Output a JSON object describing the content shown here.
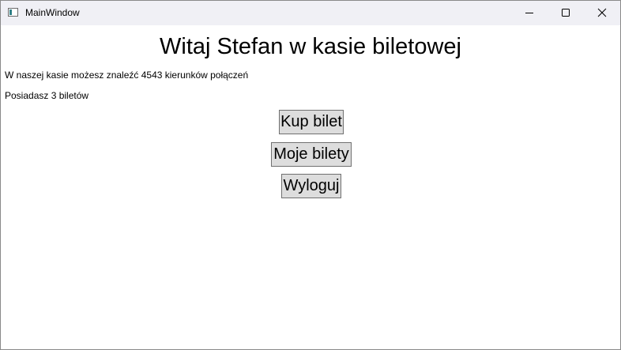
{
  "window": {
    "title": "MainWindow",
    "icon": "app-window-icon",
    "controls": {
      "minimize_icon": "minimize-icon",
      "maximize_icon": "maximize-icon",
      "close_icon": "close-icon"
    }
  },
  "main": {
    "heading": "Witaj Stefan w kasie biletowej",
    "routes_info": "W naszej kasie możesz znaleźć 4543 kierunków połączeń",
    "tickets_info": "Posiadasz 3 biletów"
  },
  "buttons": {
    "buy_ticket": "Kup bilet",
    "my_tickets": "Moje bilety",
    "logout": "Wyloguj"
  },
  "colors": {
    "titlebar_bg": "#f0f0f5",
    "button_bg": "#dddddd",
    "button_border": "#707070",
    "icon_accent": "#2f7f86"
  }
}
